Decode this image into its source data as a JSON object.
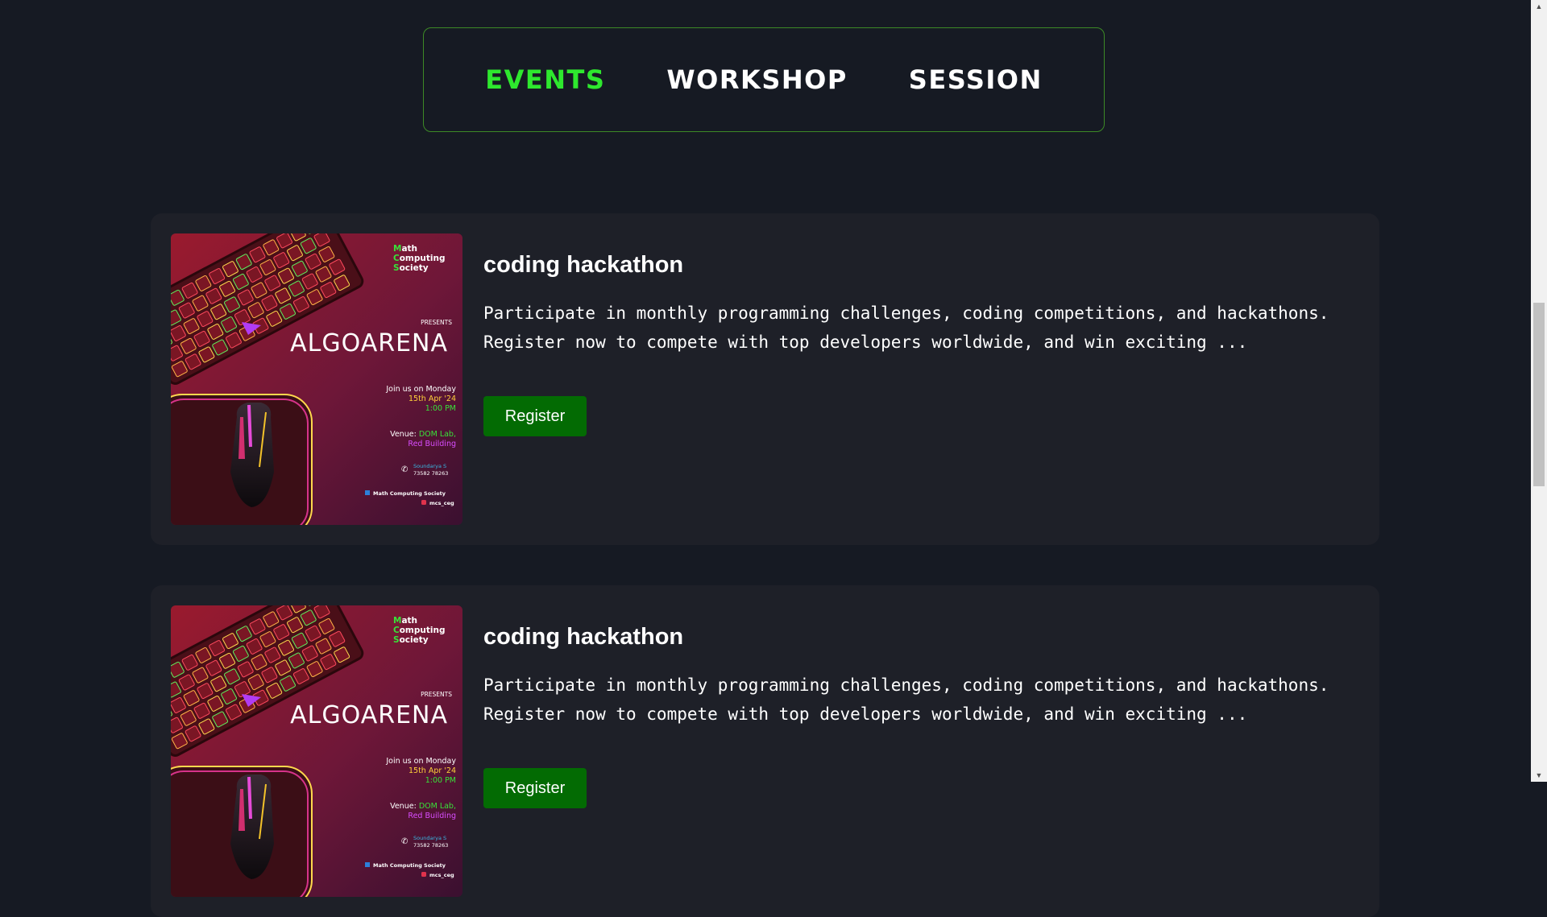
{
  "tabs": [
    {
      "label": "EVENTS",
      "active": true
    },
    {
      "label": "WORKSHOP",
      "active": false
    },
    {
      "label": "SESSION",
      "active": false
    }
  ],
  "colors": {
    "background": "#161a23",
    "card": "#1e2028",
    "accent_green": "#2ee82e",
    "button": "#036b03",
    "tab_border": "#3d8a26"
  },
  "poster": {
    "society_letters": [
      "M",
      "C",
      "S"
    ],
    "society_rest": [
      "ath",
      "omputing",
      "ociety"
    ],
    "presents": "PRESENTS",
    "event_name": "ALGOARENA",
    "join_line": "Join us on Monday",
    "date": "15th Apr '24",
    "time": "1:00 PM",
    "venue_label": "Venue:",
    "venue_place": "DOM Lab,",
    "venue_building": "Red Building",
    "contact_name": "Soundarya S",
    "contact_phone": "73582 78263",
    "social_linkedin": "Math Computing Society",
    "social_instagram": "mcs_ceg"
  },
  "events": [
    {
      "title": "coding hackathon",
      "description": "Participate in monthly programming challenges, coding competitions, and hackathons. Register now to compete with top developers worldwide, and win exciting  ...",
      "button": "Register"
    },
    {
      "title": "coding hackathon",
      "description": "Participate in monthly programming challenges, coding competitions, and hackathons. Register now to compete with top developers worldwide, and win exciting  ...",
      "button": "Register"
    }
  ]
}
